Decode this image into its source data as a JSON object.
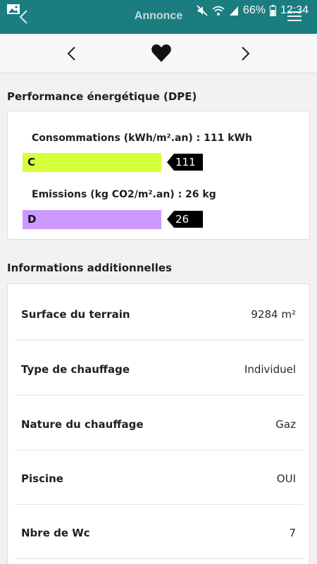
{
  "status_bar": {
    "battery_percent": "66%",
    "time": "12:34",
    "icons": [
      "image-icon",
      "mute-icon",
      "wifi-icon",
      "signal-icon",
      "battery-icon"
    ]
  },
  "header": {
    "title": "Annonce",
    "background": "#1b7d80"
  },
  "nav": {
    "icons": [
      "chevron-left-icon",
      "heart-icon",
      "chevron-right-icon"
    ]
  },
  "dpe": {
    "section_title": "Performance énergétique (DPE)",
    "consumption": {
      "label": "Consommations (kWh/m².an) : 111 kWh",
      "class": "C",
      "value": "111",
      "color": "#d4ff3a"
    },
    "emissions": {
      "label": "Emissions (kg CO2/m².an) : 26 kg",
      "class": "D",
      "value": "26",
      "color": "#cc99ff"
    }
  },
  "info": {
    "section_title": "Informations additionnelles",
    "rows": [
      {
        "key": "Surface du terrain",
        "value": "9284 m²"
      },
      {
        "key": "Type de chauffage",
        "value": "Individuel"
      },
      {
        "key": "Nature du chauffage",
        "value": "Gaz"
      },
      {
        "key": "Piscine",
        "value": "OUI"
      },
      {
        "key": "Nbre de Wc",
        "value": "7"
      }
    ]
  }
}
